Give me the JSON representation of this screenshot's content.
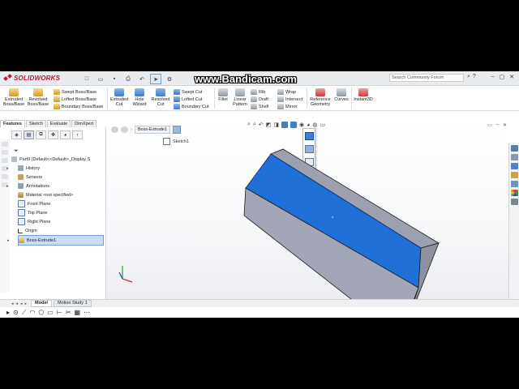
{
  "app": {
    "logo_text": "SOLIDWORKS",
    "watermark": "www.Bandicam.com",
    "search_placeholder": "Search Community Forum"
  },
  "ribbon": {
    "extruded_boss": "Extruded Boss/Base",
    "revolved_boss": "Revolved Boss/Base",
    "swept_boss": "Swept Boss/Base",
    "lofted_boss": "Lofted Boss/Base",
    "boundary_boss": "Boundary Boss/Base",
    "extruded_cut": "Extruded Cut",
    "hole_wizard": "Hole Wizard",
    "revolved_cut": "Revolved Cut",
    "swept_cut": "Swept Cut",
    "lofted_cut": "Lofted Cut",
    "boundary_cut": "Boundary Cut",
    "fillet": "Fillet",
    "linear_pattern": "Linear Pattern",
    "rib": "Rib",
    "draft": "Draft",
    "shell": "Shell",
    "wrap": "Wrap",
    "intersect": "Intersect",
    "mirror": "Mirror",
    "reference_geometry": "Reference Geometry",
    "curves": "Curves",
    "instant3d": "Instant3D"
  },
  "tabs": [
    "Features",
    "Sketch",
    "Evaluate",
    "DimXpert"
  ],
  "feature_tree": {
    "part": "Part9  (Default<<Default>_Display S",
    "items": [
      "History",
      "Sensors",
      "Annotations",
      "Material <not specified>",
      "Front Plane",
      "Top Plane",
      "Right Plane",
      "Origin",
      "Boss-Extrude1"
    ]
  },
  "graphics": {
    "flyout_feature": "Boss-Extrude1",
    "flyout_sketch": "Sketch1"
  },
  "bottom_tabs": [
    "Model",
    "Motion Study 1"
  ],
  "colors": {
    "brand": "#c8102e",
    "face_blue": "#1f6fd6",
    "body_grey": "#9fa3b2",
    "selection": "#c9ddf3"
  }
}
